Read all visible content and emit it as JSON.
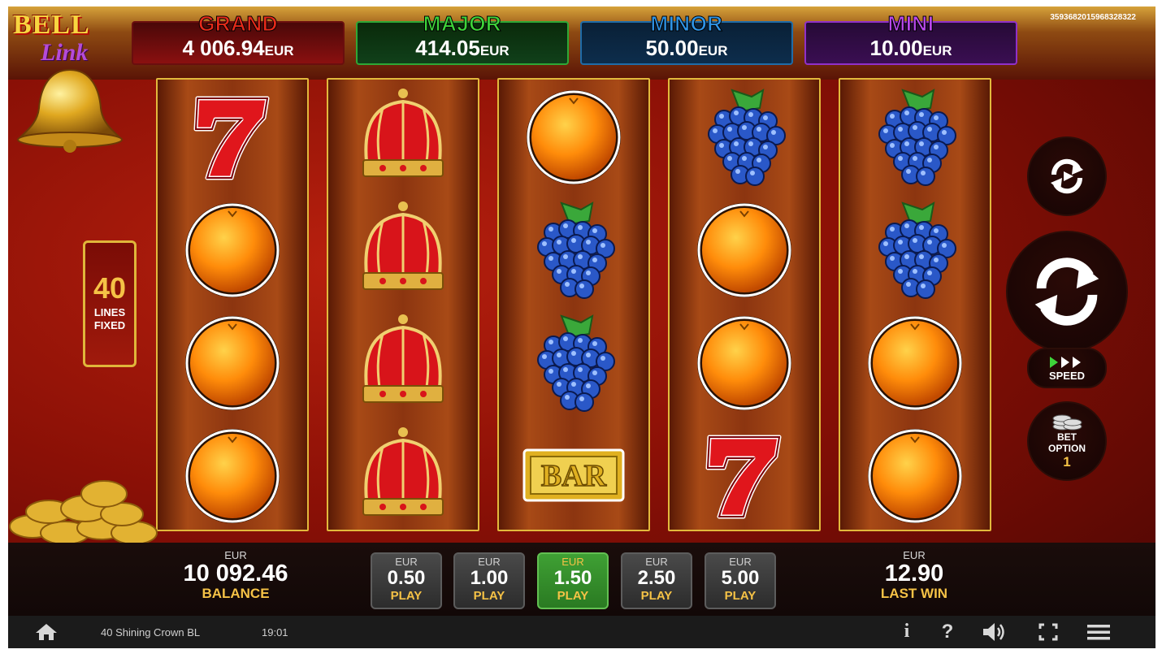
{
  "logo": {
    "line1": "BELL",
    "line2": "Link"
  },
  "jackpots": {
    "grand": {
      "name": "GRAND",
      "value": "4 006.94",
      "currency": "EUR"
    },
    "major": {
      "name": "MAJOR",
      "value": "414.05",
      "currency": "EUR"
    },
    "minor": {
      "name": "MINOR",
      "value": "50.00",
      "currency": "EUR"
    },
    "mini": {
      "name": "MINI",
      "value": "10.00",
      "currency": "EUR"
    }
  },
  "game_id": "3593682015968328322",
  "lines": {
    "count": "40",
    "label_line1": "LINES",
    "label_line2": "FIXED"
  },
  "reels": [
    [
      "seven",
      "orange",
      "orange",
      "orange"
    ],
    [
      "crown",
      "crown",
      "crown",
      "crown"
    ],
    [
      "orange",
      "grapes",
      "grapes",
      "bar"
    ],
    [
      "grapes",
      "orange",
      "orange",
      "seven"
    ],
    [
      "grapes",
      "grapes",
      "orange",
      "orange"
    ]
  ],
  "symbols": {
    "bar_text": "BAR"
  },
  "controls": {
    "autoplay_icon": "autoplay-icon",
    "spin_icon": "spin-icon",
    "speed_label": "SPEED",
    "bet_option_line1": "BET",
    "bet_option_line2": "OPTION",
    "bet_option_value": "1"
  },
  "balance": {
    "currency": "EUR",
    "amount": "10 092.46",
    "label": "BALANCE"
  },
  "bet_buttons": [
    {
      "currency": "EUR",
      "amount": "0.50",
      "label": "PLAY",
      "active": false
    },
    {
      "currency": "EUR",
      "amount": "1.00",
      "label": "PLAY",
      "active": false
    },
    {
      "currency": "EUR",
      "amount": "1.50",
      "label": "PLAY",
      "active": true
    },
    {
      "currency": "EUR",
      "amount": "2.50",
      "label": "PLAY",
      "active": false
    },
    {
      "currency": "EUR",
      "amount": "5.00",
      "label": "PLAY",
      "active": false
    }
  ],
  "last_win": {
    "currency": "EUR",
    "amount": "12.90",
    "label": "LAST WIN"
  },
  "status_bar": {
    "game_title": "40 Shining Crown BL",
    "time": "19:01",
    "icons": [
      "home-icon",
      "info-icon",
      "help-icon",
      "sound-icon",
      "fullscreen-icon",
      "menu-icon"
    ],
    "info_glyph": "i",
    "help_glyph": "?"
  },
  "colors": {
    "grand": "#e52a1a",
    "major": "#3ed43a",
    "minor": "#2f94e6",
    "mini": "#b848ec",
    "accent_gold": "#f5c246",
    "active_bet": "#3fa034"
  }
}
